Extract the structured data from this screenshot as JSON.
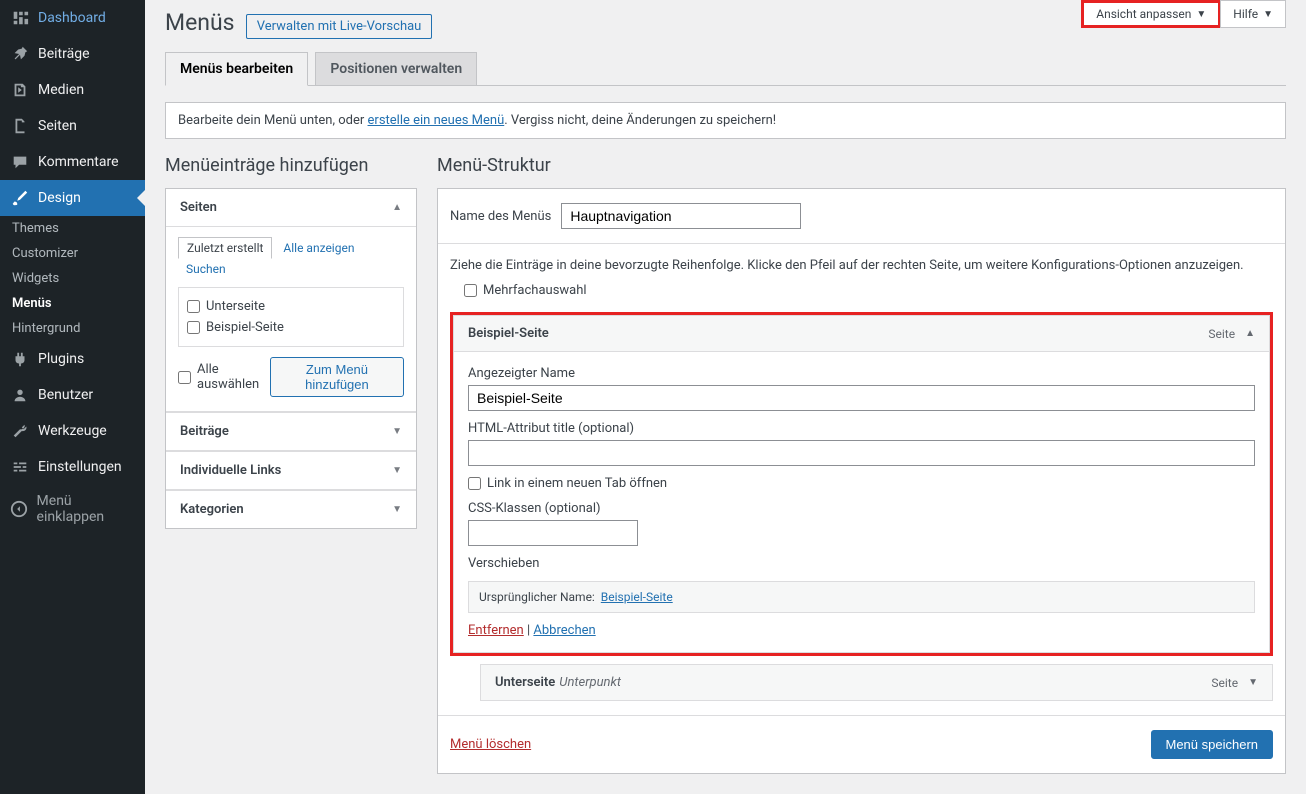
{
  "sidebar": {
    "items": [
      {
        "label": "Dashboard"
      },
      {
        "label": "Beiträge"
      },
      {
        "label": "Medien"
      },
      {
        "label": "Seiten"
      },
      {
        "label": "Kommentare"
      },
      {
        "label": "Design"
      },
      {
        "label": "Plugins"
      },
      {
        "label": "Benutzer"
      },
      {
        "label": "Werkzeuge"
      },
      {
        "label": "Einstellungen"
      }
    ],
    "design_sub": [
      {
        "label": "Themes"
      },
      {
        "label": "Customizer"
      },
      {
        "label": "Widgets"
      },
      {
        "label": "Menüs"
      },
      {
        "label": "Hintergrund"
      }
    ],
    "collapse": "Menü einklappen"
  },
  "top": {
    "customize": "Ansicht anpassen",
    "help": "Hilfe"
  },
  "page": {
    "title": "Menüs",
    "title_action": "Verwalten mit Live-Vorschau"
  },
  "tabs": {
    "edit": "Menüs bearbeiten",
    "positions": "Positionen verwalten"
  },
  "notice": {
    "pre": "Bearbeite dein Menü unten, oder ",
    "link": "erstelle ein neues Menü",
    "post": ". Vergiss nicht, deine Änderungen zu speichern!"
  },
  "left": {
    "heading": "Menüeinträge hinzufügen",
    "pages_title": "Seiten",
    "tab_recent": "Zuletzt erstellt",
    "tab_all": "Alle anzeigen",
    "tab_search": "Suchen",
    "page1": "Unterseite",
    "page2": "Beispiel-Seite",
    "select_all": "Alle auswählen",
    "add": "Zum Menü hinzufügen",
    "posts": "Beiträge",
    "custom": "Individuelle Links",
    "cats": "Kategorien"
  },
  "right": {
    "heading": "Menü-Struktur",
    "name_label": "Name des Menüs",
    "name_value": "Hauptnavigation",
    "instruction": "Ziehe die Einträge in deine bevorzugte Reihenfolge. Klicke den Pfeil auf der rechten Seite, um weitere Konfigurations-Optionen anzuzeigen.",
    "bulk": "Mehrfachauswahl",
    "item1": {
      "title": "Beispiel-Seite",
      "type": "Seite",
      "nav_label_l": "Angezeigter Name",
      "nav_label_v": "Beispiel-Seite",
      "title_attr_l": "HTML-Attribut title (optional)",
      "newtab": "Link in einem neuen Tab öffnen",
      "css_l": "CSS-Klassen (optional)",
      "move_l": "Verschieben",
      "orig_l": "Ursprünglicher Name:",
      "orig_v": "Beispiel-Seite",
      "remove": "Entfernen",
      "cancel": "Abbrechen"
    },
    "item2": {
      "title": "Unterseite",
      "subtext": "Unterpunkt",
      "type": "Seite"
    },
    "delete": "Menü löschen",
    "save": "Menü speichern"
  }
}
